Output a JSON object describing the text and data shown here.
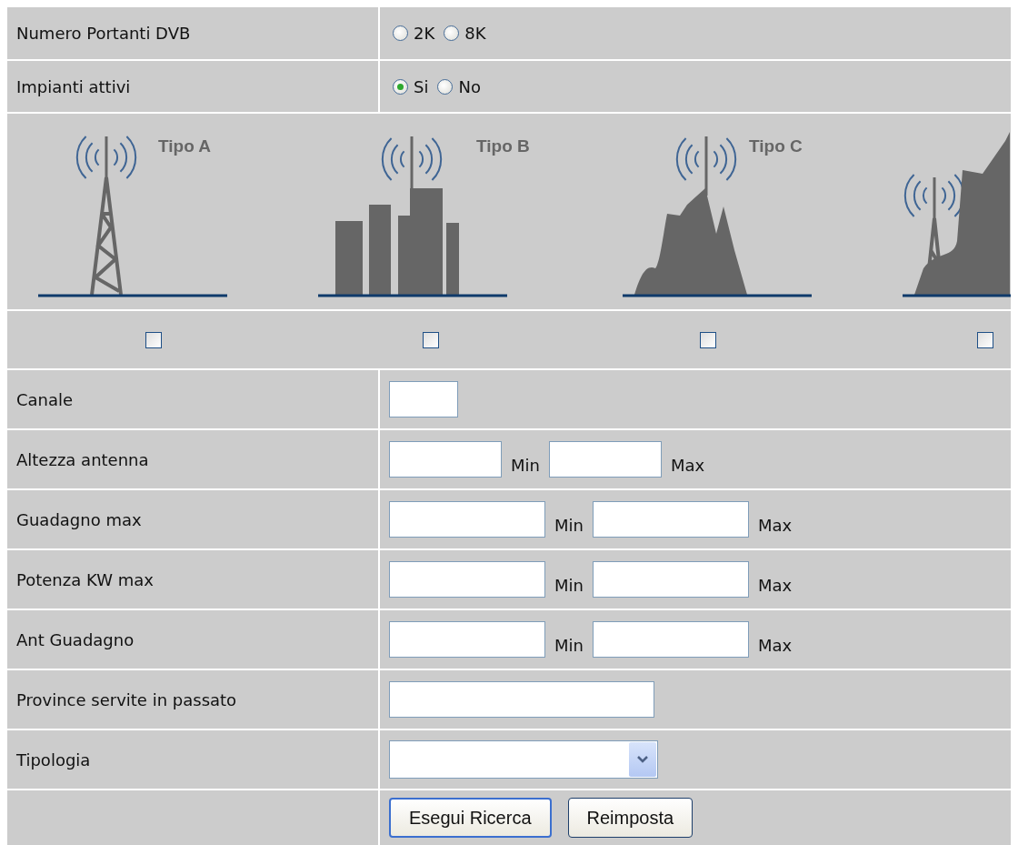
{
  "choice_rows": [
    {
      "label": "Numero Portanti DVB",
      "options": [
        {
          "label": "2K",
          "selected": false
        },
        {
          "label": "8K",
          "selected": false
        }
      ]
    },
    {
      "label": "Impianti attivi",
      "options": [
        {
          "label": "Si",
          "selected": true
        },
        {
          "label": "No",
          "selected": false
        }
      ]
    }
  ],
  "antenna_types": [
    {
      "kind": "tower",
      "label": "Tipo A",
      "checked": false
    },
    {
      "kind": "city",
      "label": "Tipo B",
      "checked": false
    },
    {
      "kind": "hill",
      "label": "Tipo C",
      "checked": false
    },
    {
      "kind": "mountain",
      "checked": false
    }
  ],
  "fields": [
    {
      "kind": "short",
      "label": "Canale"
    },
    {
      "kind": "range_narrow",
      "label": "Altezza antenna",
      "suffixes": [
        "Min",
        "Max"
      ]
    },
    {
      "kind": "range",
      "label": "Guadagno max",
      "suffixes": [
        "Min",
        "Max"
      ]
    },
    {
      "kind": "range",
      "label": "Potenza KW max",
      "suffixes": [
        "Min",
        "Max"
      ]
    },
    {
      "kind": "range",
      "label": "Ant Guadagno",
      "suffixes": [
        "Min",
        "Max"
      ]
    },
    {
      "kind": "long",
      "label": "Province servite in passato"
    },
    {
      "kind": "select",
      "label": "Tipologia"
    }
  ],
  "buttons": [
    {
      "label": "Esegui Ricerca",
      "focused": true
    },
    {
      "label": "Reimposta",
      "focused": false
    }
  ]
}
